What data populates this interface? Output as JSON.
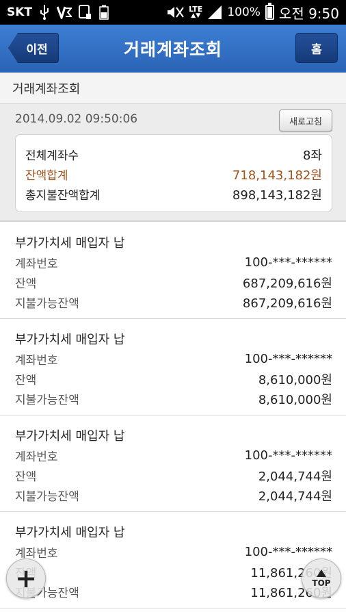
{
  "statusbar": {
    "carrier": "SKT",
    "battery_percent": "100%",
    "time": "오전 9:50",
    "network": "LTE",
    "icons": [
      "usb-icon",
      "v3-icon",
      "screen-icon",
      "battery-small-icon",
      "mute-icon",
      "lte-icon",
      "signal-icon",
      "battery-icon"
    ]
  },
  "header": {
    "back_label": "이전",
    "title": "거래계좌조회",
    "home_label": "홈"
  },
  "section": {
    "title": "거래계좌조회"
  },
  "summary": {
    "datetime": "2014.09.02  09:50:06",
    "refresh_label": "새로고침",
    "rows": [
      {
        "label": "전체계좌수",
        "value": "8좌"
      },
      {
        "label": "잔액합계",
        "value": "718,143,182원"
      },
      {
        "label": "총지불잔액합계",
        "value": "898,143,182원"
      }
    ]
  },
  "accounts": [
    {
      "name": "부가가치세 매입자 납",
      "account_no_label": "계좌번호",
      "account_no": "100-***-******",
      "balance_label": "잔액",
      "balance": "687,209,616원",
      "available_label": "지불가능잔액",
      "available": "867,209,616원"
    },
    {
      "name": "부가가치세 매입자 납",
      "account_no_label": "계좌번호",
      "account_no": "100-***-******",
      "balance_label": "잔액",
      "balance": "8,610,000원",
      "available_label": "지불가능잔액",
      "available": "8,610,000원"
    },
    {
      "name": "부가가치세 매입자 납",
      "account_no_label": "계좌번호",
      "account_no": "100-***-******",
      "balance_label": "잔액",
      "balance": "2,044,744원",
      "available_label": "지불가능잔액",
      "available": "2,044,744원"
    },
    {
      "name": "부가가치세 매입자 납",
      "account_no_label": "계좌번호",
      "account_no": "100-***-******",
      "balance_label": "잔액",
      "balance": "11,861,260원",
      "available_label": "지불가능잔액",
      "available": "11,861,260원"
    }
  ],
  "fab": {
    "top_label": "TOP"
  },
  "colors": {
    "header_blue": "#2a63b6",
    "accent_brown": "#a0521a"
  }
}
